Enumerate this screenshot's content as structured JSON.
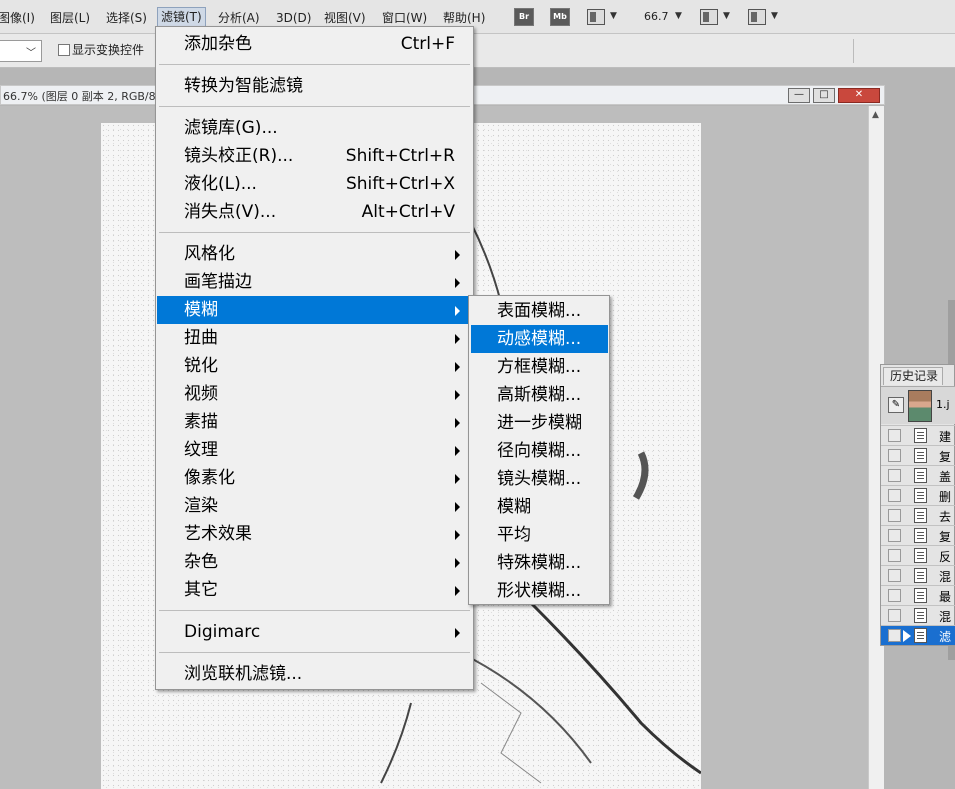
{
  "menubar": {
    "items": [
      "图像(I)",
      "图层(L)",
      "选择(S)",
      "滤镜(T)",
      "分析(A)",
      "3D(D)",
      "视图(V)",
      "窗口(W)",
      "帮助(H)"
    ],
    "active_index": 3,
    "toolbar": {
      "bridge_label": "Br",
      "mini_bridge_label": "Mb",
      "zoom_value": "66.7"
    }
  },
  "options_bar": {
    "show_transform_controls_label": "显示变换控件",
    "show_transform_controls_checked": false
  },
  "document": {
    "title": "66.7% (图层 0 副本 2, RGB/8",
    "minimize": "—",
    "maximize": "□",
    "close": "✕"
  },
  "filter_menu": {
    "groups": [
      [
        {
          "label": "添加杂色",
          "shortcut": "Ctrl+F"
        }
      ],
      [
        {
          "label": "转换为智能滤镜"
        }
      ],
      [
        {
          "label": "滤镜库(G)..."
        },
        {
          "label": "镜头校正(R)...",
          "shortcut": "Shift+Ctrl+R"
        },
        {
          "label": "液化(L)...",
          "shortcut": "Shift+Ctrl+X"
        },
        {
          "label": "消失点(V)...",
          "shortcut": "Alt+Ctrl+V"
        }
      ],
      [
        {
          "label": "风格化",
          "submenu": true
        },
        {
          "label": "画笔描边",
          "submenu": true
        },
        {
          "label": "模糊",
          "submenu": true,
          "highlighted": true
        },
        {
          "label": "扭曲",
          "submenu": true
        },
        {
          "label": "锐化",
          "submenu": true
        },
        {
          "label": "视频",
          "submenu": true
        },
        {
          "label": "素描",
          "submenu": true
        },
        {
          "label": "纹理",
          "submenu": true
        },
        {
          "label": "像素化",
          "submenu": true
        },
        {
          "label": "渲染",
          "submenu": true
        },
        {
          "label": "艺术效果",
          "submenu": true
        },
        {
          "label": "杂色",
          "submenu": true
        },
        {
          "label": "其它",
          "submenu": true
        }
      ],
      [
        {
          "label": "Digimarc",
          "submenu": true
        }
      ],
      [
        {
          "label": "浏览联机滤镜..."
        }
      ]
    ]
  },
  "blur_submenu": {
    "items": [
      "表面模糊...",
      "动感模糊...",
      "方框模糊...",
      "高斯模糊...",
      "进一步模糊",
      "径向模糊...",
      "镜头模糊...",
      "模糊",
      "平均",
      "特殊模糊...",
      "形状模糊..."
    ],
    "highlighted_index": 1
  },
  "history_panel": {
    "tab_label": "历史记录",
    "snapshot_label": "1.j",
    "rows": [
      "建",
      "复",
      "盖",
      "删",
      "去",
      "复",
      "反",
      "混",
      "最",
      "混",
      "滤"
    ],
    "selected_index": 10
  },
  "colors": {
    "menu_highlight": "#0078d7",
    "menu_bg": "#f0f0f0",
    "history_selected": "#1a6fd0"
  }
}
